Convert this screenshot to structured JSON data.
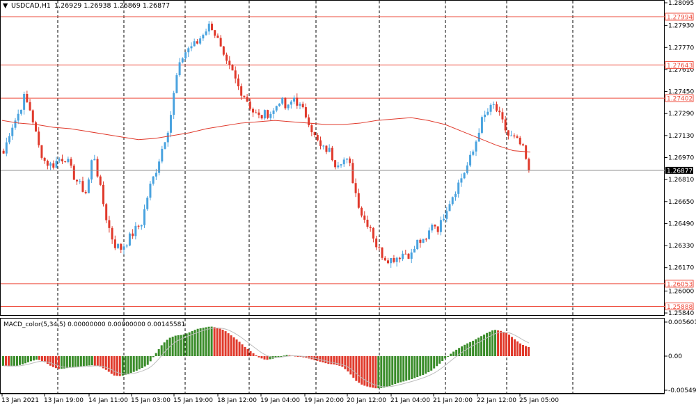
{
  "header": {
    "menu_glyph": "▼",
    "symbol": "USDCAD,H1",
    "ohlc": "1.26929 1.26938 1.26869 1.26877"
  },
  "colors": {
    "bull": "#4aa3df",
    "bear": "#e0392b",
    "level": "#ee4c3c",
    "ma": "#e0392b",
    "macd_up": "#3a8c2a",
    "macd_down": "#e0392b",
    "grid": "#000000"
  },
  "chart_data": [
    {
      "type": "candlestick",
      "symbol": "USDCAD",
      "timeframe": "H1",
      "title": "USDCAD,H1",
      "ylim": [
        1.2584,
        1.28095
      ],
      "y_ticks": [
        "1.28095",
        "1.27930",
        "1.27770",
        "1.27610",
        "1.27450",
        "1.27290",
        "1.27130",
        "1.26970",
        "1.26810",
        "1.26650",
        "1.26490",
        "1.26330",
        "1.26170",
        "1.26000",
        "1.25840"
      ],
      "x_ticks": [
        "13 Jan 2021",
        "13 Jan 19:00",
        "14 Jan 11:00",
        "15 Jan 03:00",
        "15 Jan 19:00",
        "18 Jan 12:00",
        "19 Jan 04:00",
        "19 Jan 20:00",
        "20 Jan 12:00",
        "21 Jan 04:00",
        "21 Jan 20:00",
        "22 Jan 12:00",
        "25 Jan 05:00"
      ],
      "levels": [
        "1.27994",
        "1.27643",
        "1.27402",
        "1.26053",
        "1.25888"
      ],
      "current_price": "1.26877",
      "grid": "vertical dashed",
      "close_path": [
        1.27,
        1.2718,
        1.2727,
        1.2741,
        1.273,
        1.2706,
        1.2694,
        1.2691,
        1.2696,
        1.2697,
        1.2685,
        1.2677,
        1.2671,
        1.2702,
        1.2674,
        1.265,
        1.2634,
        1.2631,
        1.2637,
        1.2644,
        1.265,
        1.2673,
        1.2687,
        1.2705,
        1.2722,
        1.2755,
        1.2772,
        1.2778,
        1.278,
        1.2789,
        1.2794,
        1.2782,
        1.2766,
        1.276,
        1.2748,
        1.2741,
        1.2731,
        1.2726,
        1.2729,
        1.273,
        1.274,
        1.2731,
        1.2741,
        1.2733,
        1.2726,
        1.2712,
        1.2703,
        1.2703,
        1.2693,
        1.2696,
        1.2693,
        1.267,
        1.2653,
        1.2648,
        1.2632,
        1.2625,
        1.2623,
        1.2625,
        1.2628,
        1.2626,
        1.2637,
        1.2634,
        1.265,
        1.2645,
        1.266,
        1.267,
        1.268,
        1.269,
        1.2702,
        1.2722,
        1.273,
        1.2735,
        1.2724,
        1.2713,
        1.271,
        1.2705,
        1.26877
      ],
      "ma_path": [
        1.2724,
        1.2722,
        1.2721,
        1.2719,
        1.2718,
        1.2716,
        1.2714,
        1.2712,
        1.271,
        1.2711,
        1.2713,
        1.2715,
        1.2718,
        1.272,
        1.2722,
        1.2723,
        1.2724,
        1.2723,
        1.2722,
        1.2721,
        1.2721,
        1.2722,
        1.2724,
        1.2725,
        1.2726,
        1.2724,
        1.2721,
        1.2716,
        1.2711,
        1.2706,
        1.2702,
        1.2701
      ],
      "series": [
        {
          "name": "Moving Average",
          "values": []
        }
      ]
    },
    {
      "type": "bar",
      "title": "MACD_color(5,34,5) 0.00000000 0.00000000 0.00145581",
      "ylim": [
        -0.005497,
        0.005601
      ],
      "y_ticks": [
        "0.0056012",
        "0.00",
        "-0.0054971"
      ],
      "zero_label": "0.00",
      "values": [
        -0.0015,
        -0.0016,
        -0.0015,
        -0.0012,
        -0.0008,
        -0.0005,
        -0.0009,
        -0.0016,
        -0.002,
        -0.0019,
        -0.0017,
        -0.0016,
        -0.0015,
        -0.0014,
        -0.0016,
        -0.0022,
        -0.003,
        -0.0031,
        -0.0028,
        -0.0024,
        -0.0019,
        -0.0013,
        0.0003,
        0.0018,
        0.0028,
        0.0032,
        0.0033,
        0.0037,
        0.0042,
        0.0044,
        0.0046,
        0.0044,
        0.004,
        0.0032,
        0.0024,
        0.0014,
        0.0006,
        -0.0002,
        -0.0006,
        -0.0004,
        -0.0001,
        0.0002,
        0.0001,
        -0.0001,
        -0.0003,
        -0.0006,
        -0.0009,
        -0.0012,
        -0.0013,
        -0.0016,
        -0.0025,
        -0.0038,
        -0.0045,
        -0.0048,
        -0.005,
        -0.0049,
        -0.0046,
        -0.0042,
        -0.0039,
        -0.0036,
        -0.0032,
        -0.0028,
        -0.0022,
        -0.0013,
        -0.0003,
        0.0006,
        0.0013,
        0.0019,
        0.0024,
        0.003,
        0.0036,
        0.0041,
        0.0039,
        0.0035,
        0.0026,
        0.0018,
        0.0014
      ]
    }
  ]
}
